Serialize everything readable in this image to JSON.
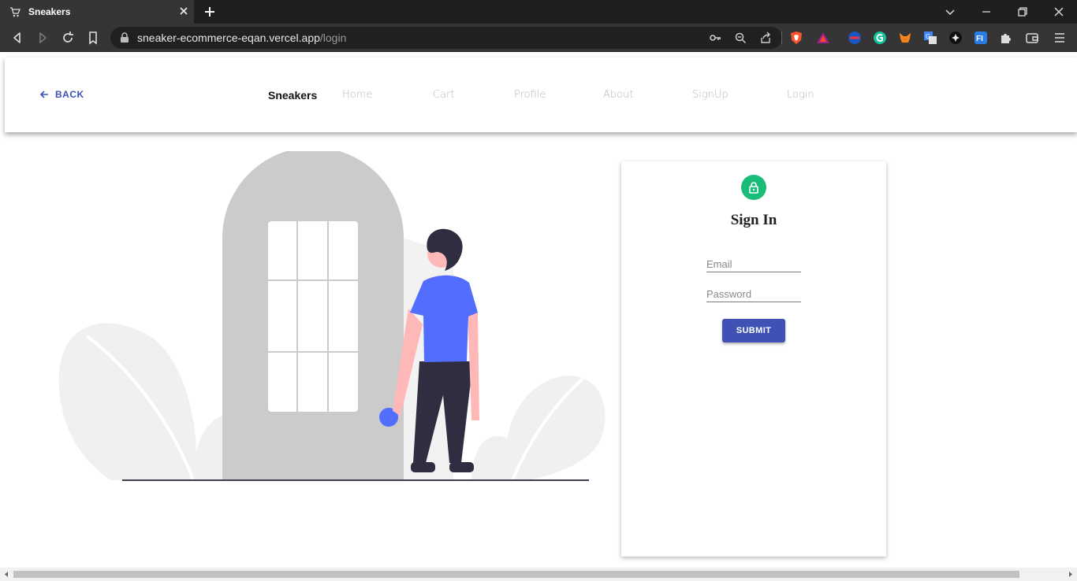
{
  "browser": {
    "tab_title": "Sneakers",
    "url_host": "sneaker-ecommerce-eqan.vercel.app",
    "url_path": "/login"
  },
  "header": {
    "back_label": "BACK",
    "brand": "Sneakers",
    "nav": [
      "Home",
      "Cart",
      "Profile",
      "About",
      "SignUp",
      "Login"
    ]
  },
  "signin": {
    "title": "Sign In",
    "email_placeholder": "Email",
    "password_placeholder": "Password",
    "submit_label": "SUBMIT"
  },
  "colors": {
    "accent": "#3f51b5",
    "lock_green": "#1abc7a",
    "shirt": "#536dfe"
  }
}
